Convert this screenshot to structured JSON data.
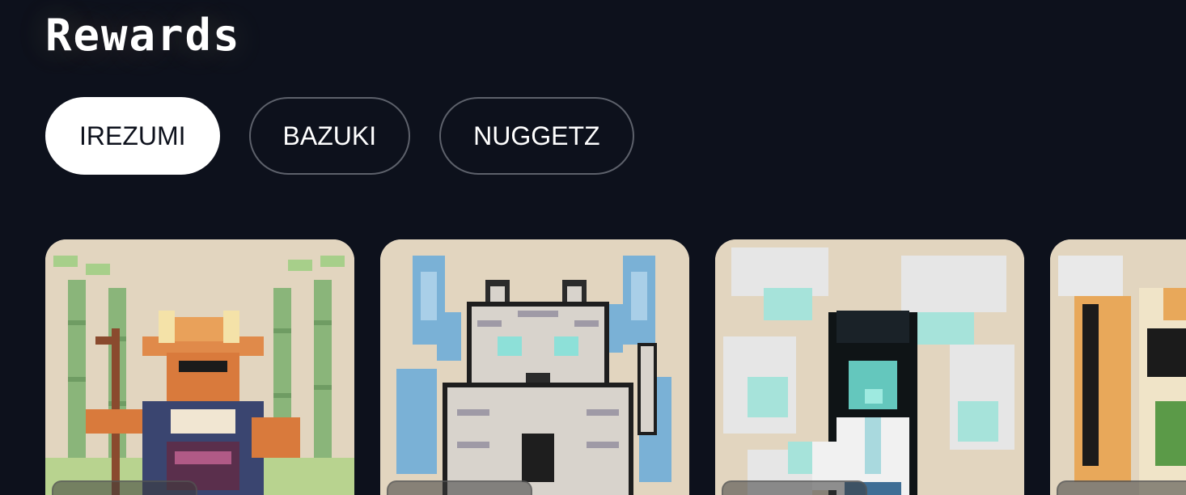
{
  "page": {
    "title": "Rewards"
  },
  "tabs": [
    {
      "label": "IREZUMI",
      "active": true
    },
    {
      "label": "BAZUKI",
      "active": false
    },
    {
      "label": "NUGGETZ",
      "active": false
    }
  ],
  "cards": [
    {
      "character": "fox-samurai-with-staff"
    },
    {
      "character": "white-tiger"
    },
    {
      "character": "ghost-girl"
    },
    {
      "character": "tanuki-warrior"
    }
  ],
  "colors": {
    "background": "#0d111c",
    "card": "#e2d5bf",
    "tab_active_bg": "#ffffff",
    "tab_border": "#5d616b"
  }
}
